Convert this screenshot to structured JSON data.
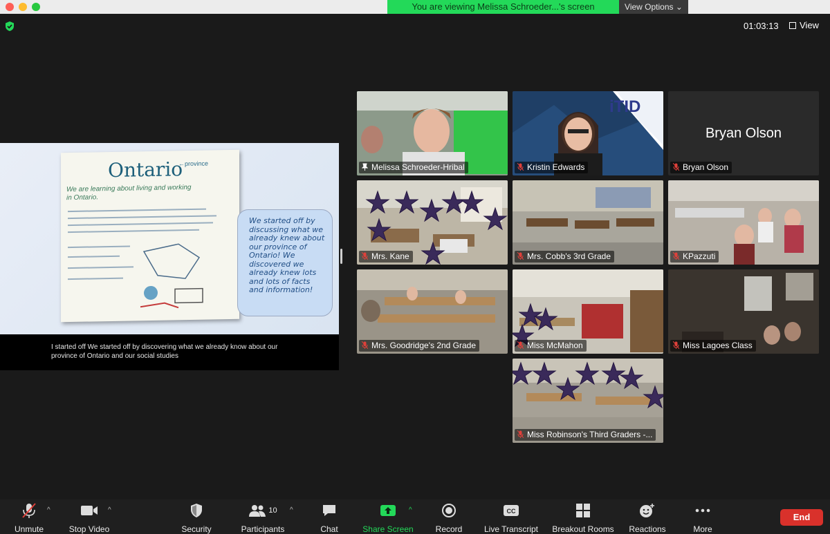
{
  "banner": {
    "viewing_text": "You are viewing Melissa Schroeder...'s screen",
    "view_options": "View Options"
  },
  "topbar": {
    "timer": "01:03:13",
    "view_label": "View"
  },
  "shared_screen": {
    "slide_title": "Ontario",
    "slide_subtitle": "←province",
    "slide_lines": [
      "We are learning about living and working",
      "in Ontario."
    ],
    "bubble_text": "We started off by discussing what we already knew about our province of Ontario! We discovered we already knew lots and lots of facts and information!",
    "caption": "I started off We started off by discovering what we already know about our province of Ontario and our social studies"
  },
  "participants": [
    {
      "name": "Melissa Schroeder-Hribal",
      "muted": false,
      "active": true
    },
    {
      "name": "Kristin Edwards",
      "muted": true
    },
    {
      "name": "Bryan Olson",
      "muted": true,
      "display_name": "Bryan Olson"
    },
    {
      "name": "Mrs. Kane",
      "muted": true
    },
    {
      "name": "Mrs. Cobb's 3rd Grade",
      "muted": true
    },
    {
      "name": "KPazzuti",
      "muted": true
    },
    {
      "name": "Mrs. Goodridge's 2nd Grade",
      "muted": true
    },
    {
      "name": "Miss McMahon",
      "muted": true
    },
    {
      "name": "Miss Lagoes Class",
      "muted": true
    },
    {
      "name": "Miss Robinson's Third Graders -...",
      "muted": true
    }
  ],
  "itid_logo_text": "iTID",
  "toolbar": {
    "unmute": "Unmute",
    "stop_video": "Stop Video",
    "security": "Security",
    "participants": "Participants",
    "participants_count": "10",
    "chat": "Chat",
    "share_screen": "Share Screen",
    "record": "Record",
    "live_transcript": "Live Transcript",
    "cc_badge": "CC",
    "breakout_rooms": "Breakout Rooms",
    "reactions": "Reactions",
    "more": "More",
    "end": "End"
  },
  "colors": {
    "accent_green": "#23d959",
    "end_red": "#d9312b",
    "background": "#1a1a1a"
  }
}
